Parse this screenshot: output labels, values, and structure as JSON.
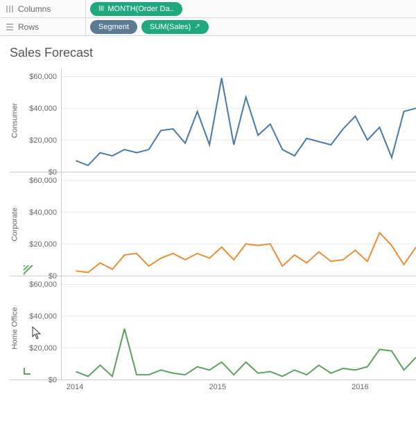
{
  "shelves": {
    "columns_label": "Columns",
    "rows_label": "Rows",
    "columns_pills": [
      {
        "label": "MONTH(Order Da..",
        "glyph": "plus"
      }
    ],
    "rows_pills": [
      {
        "label": "Segment",
        "color": "blue"
      },
      {
        "label": "SUM(Sales)",
        "color": "green",
        "glyph": "forecast"
      }
    ]
  },
  "chart_title": "Sales Forecast",
  "y_ticks": [
    "$0",
    "$20,000",
    "$40,000",
    "$60,000"
  ],
  "x_ticks": [
    "2014",
    "2015",
    "2016"
  ],
  "segments": [
    "Consumer",
    "Corporate",
    "Home Office"
  ],
  "segment_colors": {
    "Consumer": "#4a7aa6",
    "Corporate": "#f08c32",
    "Home Office": "#5fa05f"
  },
  "chart_data": {
    "type": "line",
    "title": "Sales Forecast",
    "ylabel": "Sales",
    "ylim": [
      0,
      65000
    ],
    "x": [
      "2014-01",
      "2014-02",
      "2014-03",
      "2014-04",
      "2014-05",
      "2014-06",
      "2014-07",
      "2014-08",
      "2014-09",
      "2014-10",
      "2014-11",
      "2014-12",
      "2015-01",
      "2015-02",
      "2015-03",
      "2015-04",
      "2015-05",
      "2015-06",
      "2015-07",
      "2015-08",
      "2015-09",
      "2015-10",
      "2015-11",
      "2015-12",
      "2016-01",
      "2016-02",
      "2016-03",
      "2016-04",
      "2016-05"
    ],
    "series": [
      {
        "name": "Consumer",
        "color": "#4a7aa6",
        "values": [
          7000,
          4000,
          12000,
          10000,
          14000,
          12000,
          14000,
          26000,
          27000,
          18000,
          38000,
          17000,
          59000,
          17000,
          47000,
          23000,
          30000,
          14000,
          10000,
          21000,
          19000,
          17000,
          27000,
          35000,
          20000,
          28000,
          9000,
          38000,
          40000
        ]
      },
      {
        "name": "Corporate",
        "color": "#f08c32",
        "values": [
          3000,
          2000,
          8000,
          4000,
          13000,
          14000,
          6000,
          11000,
          14000,
          10000,
          14000,
          11000,
          18000,
          10000,
          20000,
          19000,
          20000,
          6000,
          13000,
          8000,
          15000,
          9000,
          10000,
          16000,
          9000,
          27000,
          19000,
          7000,
          18000
        ]
      },
      {
        "name": "Home Office",
        "color": "#5fa05f",
        "values": [
          5000,
          2000,
          9000,
          2000,
          32000,
          3000,
          3000,
          6000,
          4000,
          3000,
          8000,
          6000,
          11000,
          3000,
          11000,
          4000,
          5000,
          2000,
          6000,
          3000,
          9000,
          4000,
          7000,
          6000,
          8000,
          19000,
          18000,
          6000,
          14000
        ]
      }
    ]
  }
}
